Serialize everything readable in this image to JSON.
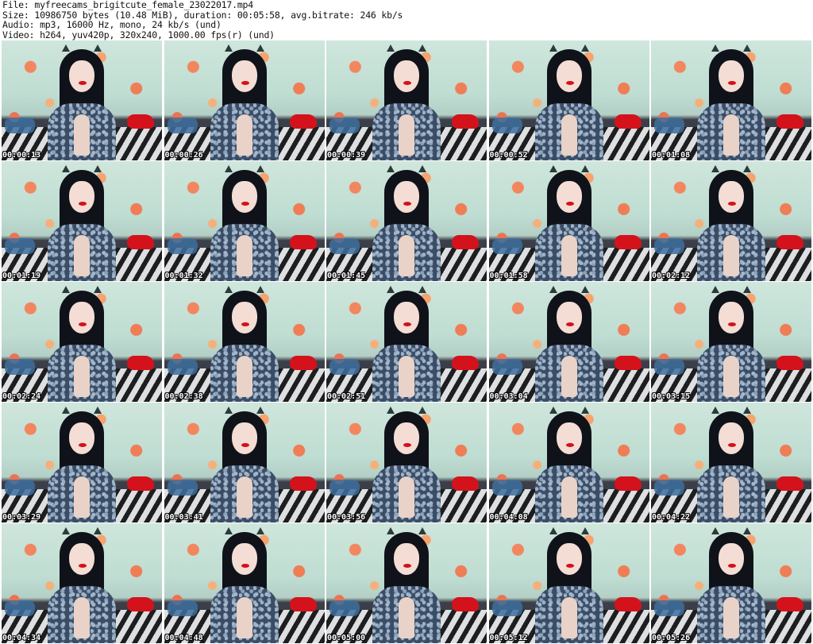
{
  "info": {
    "file": "File: myfreecams_brigitcute_female_23022017.mp4",
    "size": "Size: 10986750 bytes (10.48 MiB), duration: 00:05:58, avg.bitrate: 246 kb/s",
    "audio": "Audio: mp3, 16000 Hz, mono, 24 kb/s (und)",
    "video": "Video: h264, yuv420p, 320x240, 1000.00 fps(r) (und)"
  },
  "thumbnails": [
    {
      "timestamp": "00:00:13"
    },
    {
      "timestamp": "00:00:26"
    },
    {
      "timestamp": "00:00:39"
    },
    {
      "timestamp": "00:00:52"
    },
    {
      "timestamp": "00:01:08"
    },
    {
      "timestamp": "00:01:19"
    },
    {
      "timestamp": "00:01:32"
    },
    {
      "timestamp": "00:01:45"
    },
    {
      "timestamp": "00:01:58"
    },
    {
      "timestamp": "00:02:12"
    },
    {
      "timestamp": "00:02:24"
    },
    {
      "timestamp": "00:02:38"
    },
    {
      "timestamp": "00:02:51"
    },
    {
      "timestamp": "00:03:04"
    },
    {
      "timestamp": "00:03:15"
    },
    {
      "timestamp": "00:03:29"
    },
    {
      "timestamp": "00:03:41"
    },
    {
      "timestamp": "00:03:56"
    },
    {
      "timestamp": "00:04:08"
    },
    {
      "timestamp": "00:04:22"
    },
    {
      "timestamp": "00:04:34"
    },
    {
      "timestamp": "00:04:48"
    },
    {
      "timestamp": "00:05:00"
    },
    {
      "timestamp": "00:05:12"
    },
    {
      "timestamp": "00:05:26"
    }
  ],
  "colors": {
    "background": "#ffffff",
    "text": "#111111",
    "timestamp_text": "#ffffff",
    "timestamp_outline": "#000000"
  }
}
